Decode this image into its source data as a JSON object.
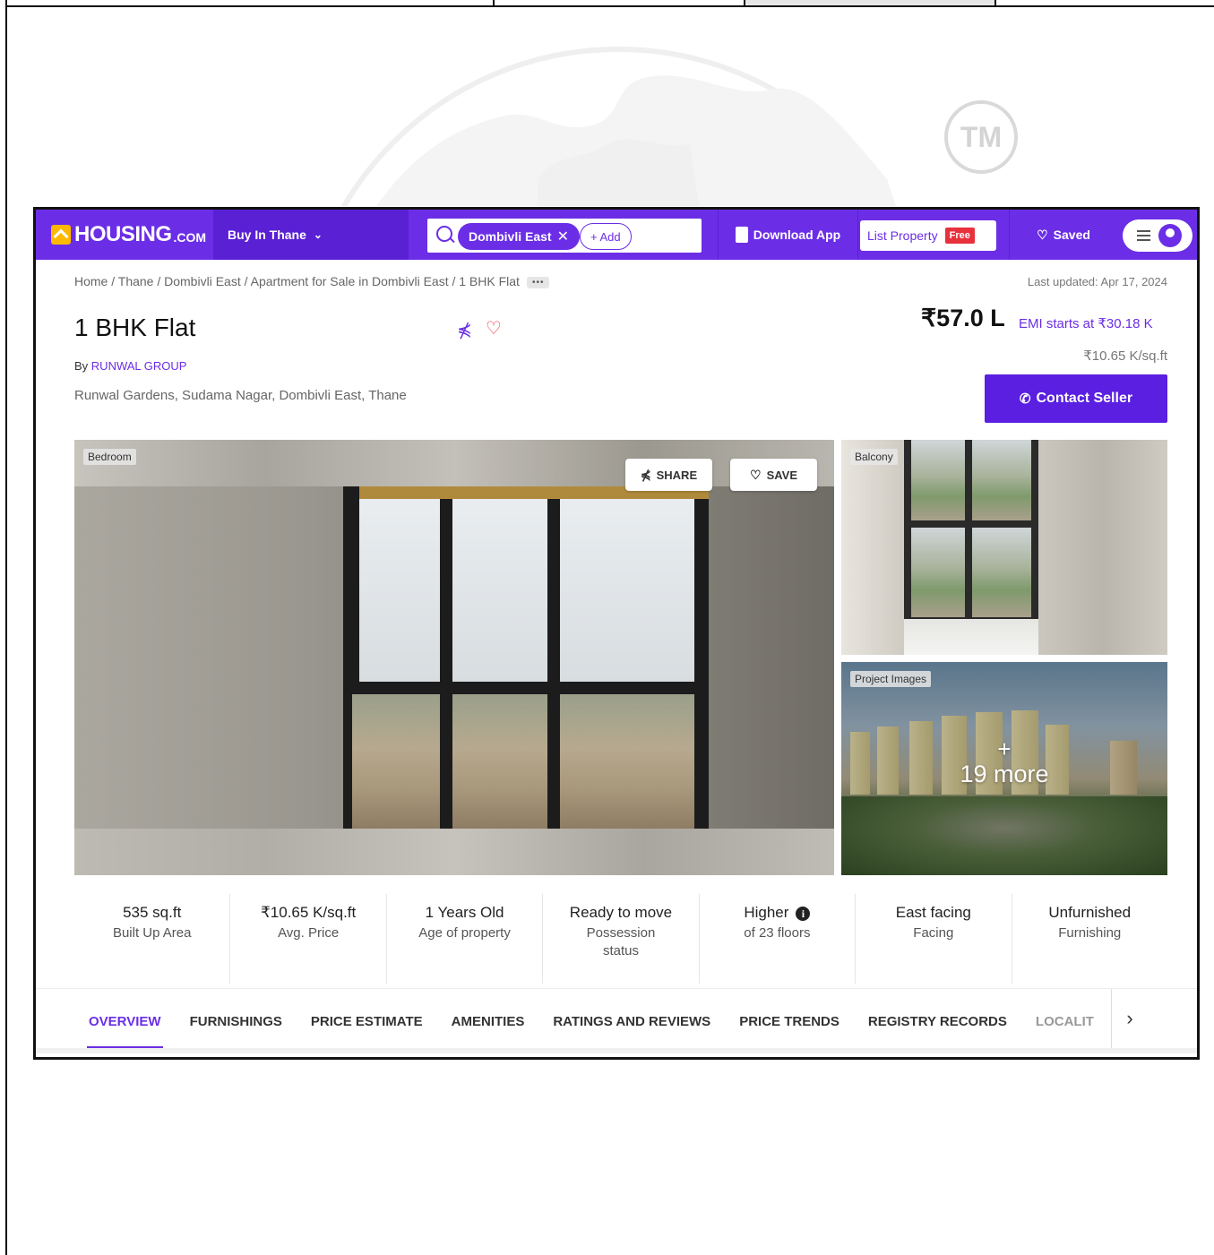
{
  "nav": {
    "logo_main": "HOUSING",
    "logo_sub": ".COM",
    "city_label": "Buy In Thane",
    "search_chip": "Dombivli East",
    "search_add": "+ Add",
    "download_app": "Download App",
    "list_property": "List Property",
    "free_badge": "Free",
    "saved": "Saved"
  },
  "breadcrumb": {
    "text": "Home / Thane / Dombivli East / Apartment for Sale in Dombivli East / 1 BHK Flat",
    "more": "•••"
  },
  "last_updated": "Last updated: Apr 17, 2024",
  "listing": {
    "title": "1 BHK Flat",
    "by_label": "By",
    "developer": "RUNWAL GROUP",
    "address": "Runwal Gardens, Sudama Nagar, Dombivli East, Thane",
    "price": "₹57.0 L",
    "emi": "EMI starts at ₹30.18 K",
    "price_per_sqft": "₹10.65 K/sq.ft",
    "contact_button": "Contact Seller"
  },
  "gallery": {
    "main_tag": "Bedroom",
    "share_label": "SHARE",
    "save_label": "SAVE",
    "side1_tag": "Balcony",
    "side2_tag": "Project Images",
    "more_plus": "+",
    "more_count": "19 more"
  },
  "stats": [
    {
      "value": "535 sq.ft",
      "label": "Built Up Area"
    },
    {
      "value": "₹10.65 K/sq.ft",
      "label": "Avg. Price"
    },
    {
      "value": "1 Years Old",
      "label": "Age of property"
    },
    {
      "value": "Ready to move",
      "label": "Possession status"
    },
    {
      "value": "Higher",
      "label": "of 23 floors"
    },
    {
      "value": "East facing",
      "label": "Facing"
    },
    {
      "value": "Unfurnished",
      "label": "Furnishing"
    }
  ],
  "tabs": [
    "OVERVIEW",
    "FURNISHINGS",
    "PRICE ESTIMATE",
    "AMENITIES",
    "RATINGS AND REVIEWS",
    "PRICE TRENDS",
    "REGISTRY RECORDS",
    "LOCALIT"
  ],
  "watermark": {
    "tm": "TM"
  },
  "colors": {
    "brand": "#6b2ee6",
    "accent_red": "#e8313c",
    "logo_yellow": "#ffb800"
  }
}
